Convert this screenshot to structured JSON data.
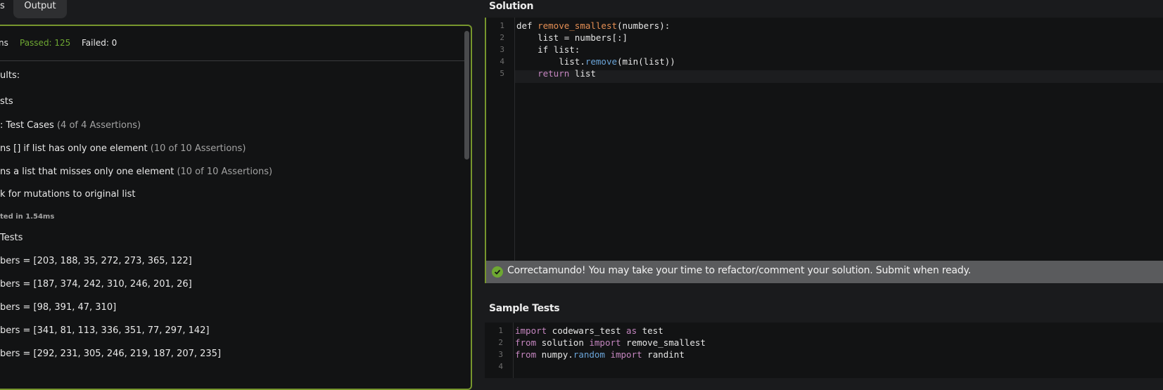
{
  "left_panel": {
    "tabs": {
      "tests_fragment": "s",
      "output": "Output"
    },
    "stats": {
      "prefix": "ns",
      "passed": "Passed: 125",
      "failed": "Failed: 0"
    },
    "lines": [
      {
        "text": "ults:",
        "note": ""
      },
      {
        "text": "sts",
        "note": ""
      },
      {
        "text": ": Test Cases",
        "note": "(4 of 4 Assertions)"
      },
      {
        "text": "ns [] if list has only one element",
        "note": "(10 of 10 Assertions)"
      },
      {
        "text": "ns a list that misses only one element",
        "note": "(10 of 10 Assertions)"
      },
      {
        "text": "k for mutations to original list",
        "note": ""
      },
      {
        "text": "ted in 1.54ms",
        "note": ""
      },
      {
        "text": " Tests",
        "note": ""
      },
      {
        "text": "bers = [203, 188, 35, 272, 273, 365, 122]",
        "note": ""
      },
      {
        "text": "bers = [187, 374, 242, 310, 246, 201, 26]",
        "note": ""
      },
      {
        "text": "bers = [98, 391, 47, 310]",
        "note": ""
      },
      {
        "text": "bers = [341, 81, 113, 336, 351, 77, 297, 142]",
        "note": ""
      },
      {
        "text": "bers = [292, 231, 305, 246, 219, 187, 207, 235]",
        "note": ""
      }
    ]
  },
  "solution": {
    "title": "Solution",
    "line_numbers": [
      "1",
      "2",
      "3",
      "4",
      "5"
    ],
    "code": {
      "l1_def": "def",
      "l1_fn": "remove_smallest",
      "l1_rest": "(numbers):",
      "l2": "    list = numbers[:]",
      "l3_kw": "if",
      "l3_rest": " list:",
      "l4_a": "list.",
      "l4_meth": "remove",
      "l4_b": "(min(list))",
      "l5_kw": "return",
      "l5_rest": " list"
    },
    "success_message": "Correctamundo! You may take your time to refactor/comment your solution. Submit when ready.",
    "success_icon": "check-circle-icon"
  },
  "sample_tests": {
    "title": "Sample Tests",
    "line_numbers": [
      "1",
      "2",
      "3",
      "4"
    ],
    "code": {
      "l1_kw": "import",
      "l1_mod": " codewars_test ",
      "l1_as": "as",
      "l1_rest": " test",
      "l2_kw": "from",
      "l2_mod": " solution ",
      "l2_imp": "import",
      "l2_rest": " remove_smallest",
      "l3_kw": "from",
      "l3_mod_a": " numpy.",
      "l3_mod_b": "random",
      "l3_imp": " import",
      "l3_rest": " randint"
    }
  },
  "colors": {
    "accent": "#77962d",
    "passed": "#6ea832",
    "keyword": "#c586c0",
    "function": "#e58f54"
  }
}
